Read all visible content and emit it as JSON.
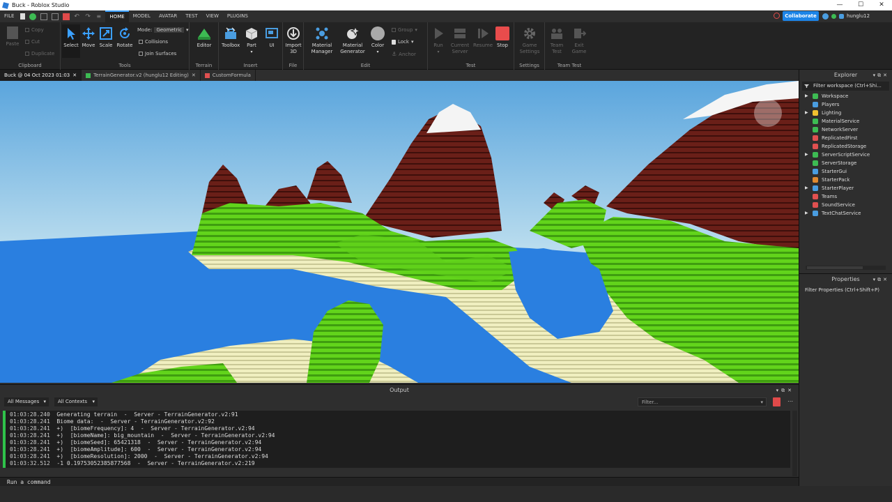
{
  "window": {
    "title": "Buck - Roblox Studio"
  },
  "menu": {
    "file": "FILE",
    "tabs": [
      "HOME",
      "MODEL",
      "AVATAR",
      "TEST",
      "VIEW",
      "PLUGINS"
    ]
  },
  "collaborate": "Collaborate",
  "user": {
    "name": "hunglu12"
  },
  "ribbon": {
    "clipboard": {
      "label": "Clipboard",
      "paste": "Paste",
      "copy": "Copy",
      "cut": "Cut",
      "duplicate": "Duplicate"
    },
    "tools": {
      "label": "Tools",
      "select": "Select",
      "move": "Move",
      "scale": "Scale",
      "rotate": "Rotate",
      "mode_label": "Mode:",
      "mode_value": "Geometric",
      "collisions": "Collisions",
      "join_surfaces": "Join Surfaces"
    },
    "terrain": {
      "label": "Terrain",
      "editor": "Editor"
    },
    "insert": {
      "label": "Insert",
      "toolbox": "Toolbox",
      "part": "Part",
      "ui": "UI"
    },
    "file": {
      "label": "File",
      "import3d_1": "Import",
      "import3d_2": "3D"
    },
    "edit": {
      "label": "Edit",
      "material_manager_1": "Material",
      "material_manager_2": "Manager",
      "material_generator_1": "Material",
      "material_generator_2": "Generator",
      "color": "Color",
      "group": "Group",
      "lock": "Lock",
      "anchor": "Anchor"
    },
    "test": {
      "label": "Test",
      "run": "Run",
      "current_server_1": "Current",
      "current_server_2": "Server",
      "resume": "Resume",
      "stop": "Stop"
    },
    "settings": {
      "label": "Settings",
      "game_settings_1": "Game",
      "game_settings_2": "Settings"
    },
    "team_test": {
      "label": "Team Test",
      "team_test_1": "Team",
      "team_test_2": "Test",
      "exit_game_1": "Exit",
      "exit_game_2": "Game"
    }
  },
  "doc_tabs": [
    {
      "label": "Buck @ 04 Oct 2023 01:03"
    },
    {
      "label": "TerrainGenerator.v2 (hunglu12 Editing)"
    },
    {
      "label": "CustomFormula"
    }
  ],
  "output": {
    "title": "Output",
    "all_messages": "All Messages",
    "all_contexts": "All Contexts",
    "filter_placeholder": "Filter...",
    "lines": [
      {
        "ts": "01:03:28.240",
        "msg": "  Generating terrain  -  Server - TerrainGenerator.v2:91"
      },
      {
        "ts": "01:03:28.241",
        "msg": "  Biome data:  -  Server - TerrainGenerator.v2:92"
      },
      {
        "ts": "01:03:28.241",
        "msg": "  +)  [biomeFrequency]: 4  -  Server - TerrainGenerator.v2:94"
      },
      {
        "ts": "01:03:28.241",
        "msg": "  +)  [biomeName]: big_mountain  -  Server - TerrainGenerator.v2:94"
      },
      {
        "ts": "01:03:28.241",
        "msg": "  +)  [biomeSeed]: 65421318  -  Server - TerrainGenerator.v2:94"
      },
      {
        "ts": "01:03:28.241",
        "msg": "  +)  [biomeAmplitude]: 600  -  Server - TerrainGenerator.v2:94"
      },
      {
        "ts": "01:03:28.241",
        "msg": "  +)  [biomeResolution]: 2000  -  Server - TerrainGenerator.v2:94"
      },
      {
        "ts": "01:03:32.512",
        "msg": "  -1 0.19753052385877568  -  Server - TerrainGenerator.v2:219"
      }
    ]
  },
  "command_bar": {
    "placeholder": "Run a command"
  },
  "explorer": {
    "title": "Explorer",
    "filter": "Filter workspace (Ctrl+Shi...",
    "items": [
      {
        "label": "Workspace",
        "expandable": true,
        "color": "#3dbb53"
      },
      {
        "label": "Players",
        "expandable": false,
        "color": "#4a9de0"
      },
      {
        "label": "Lighting",
        "expandable": true,
        "color": "#f0c030"
      },
      {
        "label": "MaterialService",
        "expandable": false,
        "color": "#3dbb53"
      },
      {
        "label": "NetworkServer",
        "expandable": false,
        "color": "#3dbb53"
      },
      {
        "label": "ReplicatedFirst",
        "expandable": false,
        "color": "#e05050"
      },
      {
        "label": "ReplicatedStorage",
        "expandable": false,
        "color": "#e05050"
      },
      {
        "label": "ServerScriptService",
        "expandable": true,
        "color": "#3dbb53"
      },
      {
        "label": "ServerStorage",
        "expandable": false,
        "color": "#3dbb53"
      },
      {
        "label": "StarterGui",
        "expandable": false,
        "color": "#4a9de0"
      },
      {
        "label": "StarterPack",
        "expandable": false,
        "color": "#e08a30"
      },
      {
        "label": "StarterPlayer",
        "expandable": true,
        "color": "#4a9de0"
      },
      {
        "label": "Teams",
        "expandable": false,
        "color": "#e05050"
      },
      {
        "label": "SoundService",
        "expandable": false,
        "color": "#e05050"
      },
      {
        "label": "TextChatService",
        "expandable": true,
        "color": "#4a9de0"
      }
    ]
  },
  "properties": {
    "title": "Properties",
    "filter": "Filter Properties (Ctrl+Shift+P)"
  }
}
